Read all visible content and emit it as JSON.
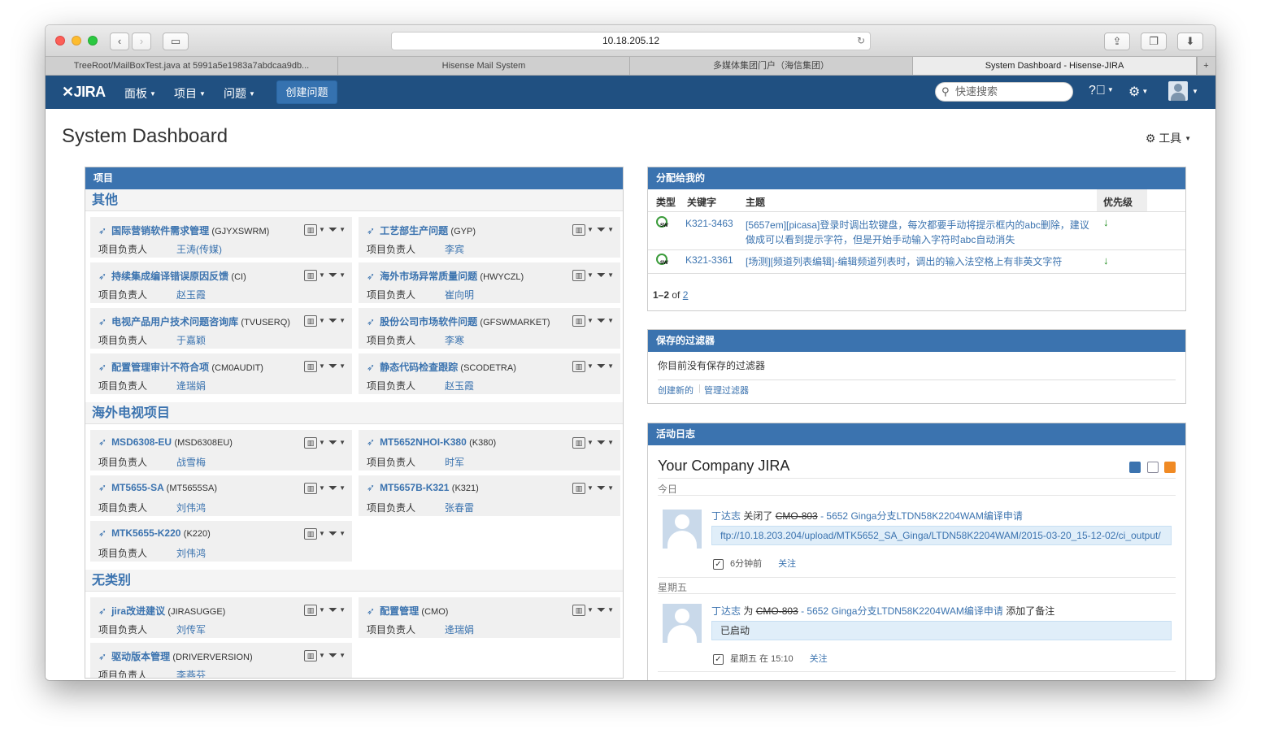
{
  "browser": {
    "url": "10.18.205.12",
    "tabs": [
      {
        "title": "TreeRoot/MailBoxTest.java at 5991a5e1983a7abdcaa9db...",
        "active": false
      },
      {
        "title": "Hisense Mail System",
        "active": false
      },
      {
        "title": "多媒体集团门户（海信集团）",
        "active": false
      },
      {
        "title": "System Dashboard - Hisense-JIRA",
        "active": true
      }
    ]
  },
  "header": {
    "logo": "JIRA",
    "menus": [
      "面板",
      "项目",
      "问题"
    ],
    "create_label": "创建问题",
    "search_placeholder": "快速搜索"
  },
  "page": {
    "title": "System Dashboard",
    "tools_label": "工具"
  },
  "projects_gadget": {
    "title": "项目",
    "lead_label": "项目负责人",
    "categories": [
      {
        "name": "其他",
        "projects": [
          {
            "name": "国际营销软件需求管理",
            "key": "(GJYXSWRM)",
            "lead": "王涛(传媒)"
          },
          {
            "name": "工艺部生产问题",
            "key": "(GYP)",
            "lead": "李宾"
          },
          {
            "name": "持续集成编译错误原因反馈",
            "key": "(CI)",
            "lead": "赵玉霞"
          },
          {
            "name": "海外市场异常质量问题",
            "key": "(HWYCZL)",
            "lead": "崔向明"
          },
          {
            "name": "电视产品用户技术问题咨询库",
            "key": "(TVUSERQ)",
            "lead": "于嘉颖"
          },
          {
            "name": "股份公司市场软件问题",
            "key": "(GFSWMARKET)",
            "lead": "李寒"
          },
          {
            "name": "配置管理审计不符合项",
            "key": "(CM0AUDIT)",
            "lead": "逄瑞娟"
          },
          {
            "name": "静态代码检查跟踪",
            "key": "(SCODETRA)",
            "lead": "赵玉霞"
          }
        ]
      },
      {
        "name": "海外电视项目",
        "projects": [
          {
            "name": "MSD6308-EU",
            "key": "(MSD6308EU)",
            "lead": "战雪梅"
          },
          {
            "name": "MT5652NHOI-K380",
            "key": "(K380)",
            "lead": "时军"
          },
          {
            "name": "MT5655-SA",
            "key": "(MT5655SA)",
            "lead": "刘伟鸿"
          },
          {
            "name": "MT5657B-K321",
            "key": "(K321)",
            "lead": "张春雷"
          },
          {
            "name": "MTK5655-K220",
            "key": "(K220)",
            "lead": "刘伟鸿"
          }
        ]
      },
      {
        "name": "无类别",
        "projects": [
          {
            "name": "jira改进建议",
            "key": "(JIRASUGGE)",
            "lead": "刘传军"
          },
          {
            "name": "配置管理",
            "key": "(CMO)",
            "lead": "逄瑞娟"
          },
          {
            "name": "驱动版本管理",
            "key": "(DRIVERVERSION)",
            "lead": "李燕芬"
          }
        ]
      }
    ]
  },
  "assigned_gadget": {
    "title": "分配给我的",
    "columns": {
      "type": "类型",
      "key": "关键字",
      "summary": "主题",
      "priority": "优先级"
    },
    "rows": [
      {
        "type_icon": "sw",
        "key": "K321-3463",
        "summary": "[5657em][picasa]登录时调出软键盘，每次都要手动将提示框内的abc删除，建议做成可以看到提示字符，但是开始手动输入字符时abc自动消失",
        "priority_icon": "down-arrow"
      },
      {
        "type_icon": "sw",
        "key": "K321-3361",
        "summary": "[场测][频道列表编辑]-编辑频道列表时，调出的输入法空格上有非英文字符",
        "priority_icon": "down-arrow"
      }
    ],
    "pager": {
      "range": "1–2",
      "of": "of",
      "total": "2"
    }
  },
  "filters_gadget": {
    "title": "保存的过滤器",
    "empty_text": "你目前没有保存的过滤器",
    "create_link": "创建新的",
    "manage_link": "管理过滤器"
  },
  "activity_gadget": {
    "title": "活动日志",
    "stream_title": "Your Company JIRA",
    "groups": [
      {
        "day": "今日",
        "entry": {
          "user": "丁达志",
          "verb": "关闭了",
          "issue_key": "CMO-803",
          "issue_title": "- 5652 Ginga分支LTDN58K2204WAM编译申请",
          "suffix": "",
          "content": "ftp://10.18.203.204/upload/MTK5652_SA_Ginga/LTDN58K2204WAM/2015-03-20_15-12-02/ci_output/",
          "time": "6分钟前",
          "watch": "关注"
        }
      },
      {
        "day": "星期五",
        "entry": {
          "user": "丁达志",
          "verb": "为",
          "issue_key": "CMO-803",
          "issue_title": "- 5652 Ginga分支LTDN58K2204WAM编译申请",
          "suffix": "添加了备注",
          "content": "已启动",
          "time": "星期五 在 15:10",
          "watch": "关注"
        }
      }
    ]
  },
  "colors": {
    "header_bg": "#205081",
    "gadget_head": "#3b73af",
    "link": "#3b73af",
    "priority_low": "#1b8b1b"
  }
}
